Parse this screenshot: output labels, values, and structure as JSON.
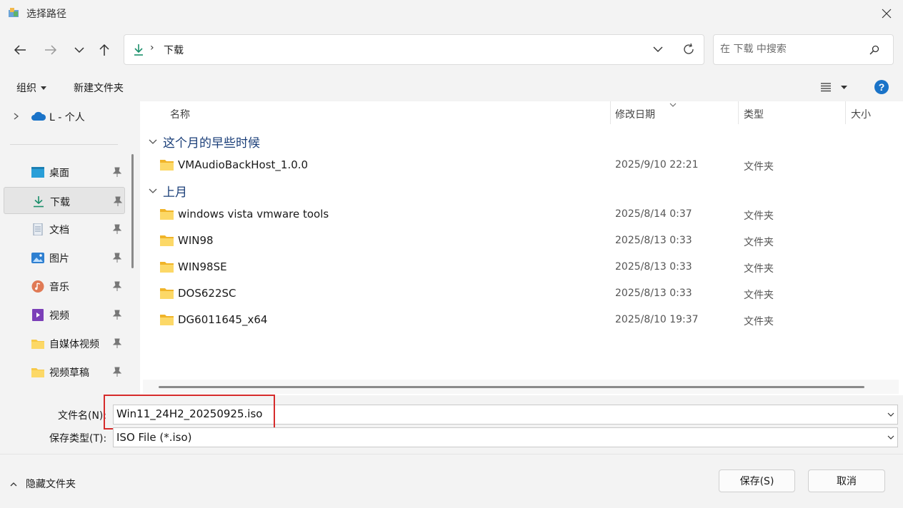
{
  "window": {
    "title": "选择路径"
  },
  "address": {
    "current": "下载"
  },
  "search": {
    "placeholder": "在 下载 中搜索"
  },
  "toolbar": {
    "organize_label": "组织",
    "new_folder_label": "新建文件夹"
  },
  "sidebar": {
    "cloud_label": "L - 个人",
    "items": [
      {
        "label": "桌面"
      },
      {
        "label": "下载"
      },
      {
        "label": "文档"
      },
      {
        "label": "图片"
      },
      {
        "label": "音乐"
      },
      {
        "label": "视频"
      },
      {
        "label": "自媒体视频"
      },
      {
        "label": "视频草稿"
      }
    ]
  },
  "columns": {
    "name": "名称",
    "date": "修改日期",
    "type": "类型",
    "size": "大小"
  },
  "groups": [
    {
      "label": "这个月的早些时候"
    },
    {
      "label": "上月"
    }
  ],
  "files": [
    {
      "name": "VMAudioBackHost_1.0.0",
      "date": "2025/9/10 22:21",
      "type": "文件夹"
    },
    {
      "name": "windows vista vmware tools",
      "date": "2025/8/14 0:37",
      "type": "文件夹"
    },
    {
      "name": "WIN98",
      "date": "2025/8/13 0:33",
      "type": "文件夹"
    },
    {
      "name": "WIN98SE",
      "date": "2025/8/13 0:33",
      "type": "文件夹"
    },
    {
      "name": "DOS622SC",
      "date": "2025/8/13 0:33",
      "type": "文件夹"
    },
    {
      "name": "DG6011645_x64",
      "date": "2025/8/10 19:37",
      "type": "文件夹"
    }
  ],
  "form": {
    "filename_label": "文件名(N):",
    "filename_value": "Win11_24H2_20250925.iso",
    "filetype_label": "保存类型(T):",
    "filetype_value": "ISO File (*.iso)"
  },
  "footer": {
    "hide_folders_label": "隐藏文件夹",
    "save_label": "保存(S)",
    "cancel_label": "取消"
  },
  "colors": {
    "accent": "#0067c0",
    "highlight_box": "#d62b2b",
    "folder": "#f7c948"
  }
}
